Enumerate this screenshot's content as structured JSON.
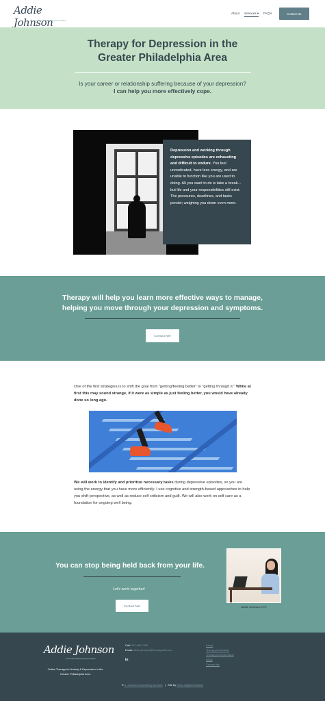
{
  "header": {
    "logo_text": "Addie Johnson",
    "logo_sub": "Licensed Professional Counselor",
    "nav": {
      "about": "About",
      "services": "Services",
      "services_caret": "▾",
      "faqs": "FAQ's"
    },
    "contact_button": "Contact Me"
  },
  "hero": {
    "title_line1": "Therapy for Depression in the",
    "title_line2": "Greater Philadelphia Area",
    "question": "Is your career or relationship suffering because of your depression?",
    "answer": "I can help you more effectively cope."
  },
  "depression_card": {
    "bold": "Depression and working through depressive episodes are exhausting and difficult to endure.",
    "text": " You feel unmotivated, have less energy, and are unable to function like you are used to doing. All you want to do is take a break... but life and your responsibilities still exist. The pressures, deadlines, and tasks persist; weighing you down even more."
  },
  "band1": {
    "line1": "Therapy will help you learn more effective ways to manage,",
    "line2": "helping  you move through your depression and symptoms.",
    "button": "Contact Me!"
  },
  "strategy": {
    "p1_text": "One of the first strategies is to shift the goal from \"getting/feeling better\" to \"getting through it.\"  ",
    "p1_bold": "While at first this may sound strange, if it were as simple as just feeling better, you would have already done so long ago.",
    "p2_bold": "We will work to identify and prioritize necessary tasks",
    "p2_text": " during depressive episodes, so you are using the energy that you have more efficiently.  I use cognitive and strength-based approaches to help you shift perspective, as well as reduce self criticism and guilt.  We will also work on self care as a foundation for ongoing well being."
  },
  "band2": {
    "title": "You can stop being held back from your life.",
    "lets_work": "Let's work together!",
    "button": "Contact Me!",
    "caption": "Addie Johnson, LPC"
  },
  "footer": {
    "logo_text": "Addie Johnson",
    "logo_sub": "Licensed Professional Counselor",
    "tagline": "Online Therapy for Anxiety & Depression in the Greater Philadelphia Area",
    "call_label": "Call:",
    "call_value": "267-990-7992",
    "email_label": "Email:",
    "email_value": "addie.johnson@therapymail.com",
    "linkedin": "in",
    "links": [
      "About",
      "Therapy for Anxiety",
      "Therapy for Depression",
      "FAQs",
      "Contact Me"
    ],
    "copyright_prefix": "© ",
    "copyright_link": "A. Johnson Counseling Services",
    "separator": "|",
    "site_by_label": "Site by",
    "site_by_link": "Shine Digital Solutions"
  },
  "colors": {
    "navy": "#36474f",
    "mint": "#c4e1c7",
    "teal": "#6a9e96",
    "button_slate": "#607f89"
  }
}
